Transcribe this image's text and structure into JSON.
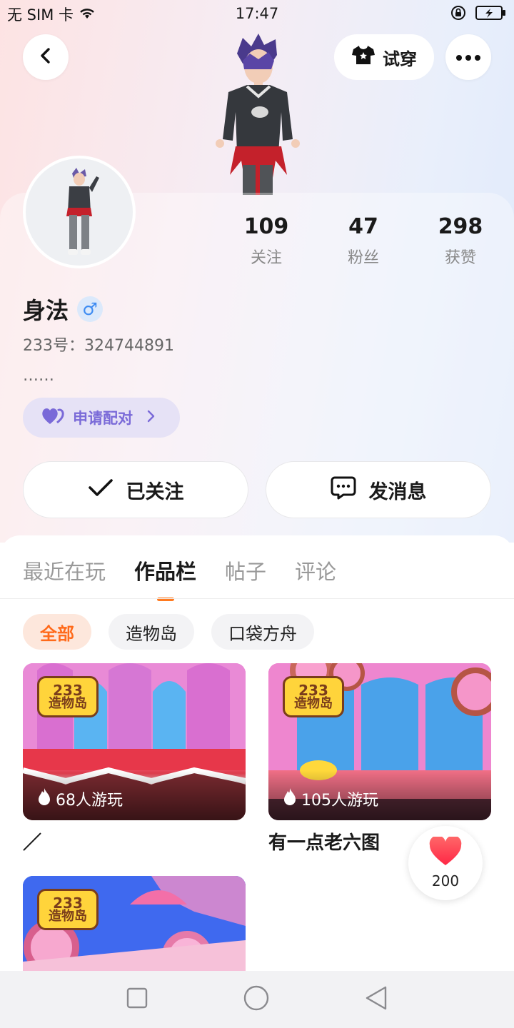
{
  "status_bar": {
    "carrier": "无 SIM 卡",
    "time": "17:47"
  },
  "header": {
    "back_icon": "chevron-left-icon",
    "tryon_label": "试穿",
    "more_icon": "more-horizontal-icon"
  },
  "profile": {
    "stats": [
      {
        "value": "109",
        "label": "关注"
      },
      {
        "value": "47",
        "label": "粉丝"
      },
      {
        "value": "298",
        "label": "获赞"
      }
    ],
    "name": "身法",
    "gender_symbol": "♂",
    "uid": "233号：324744891",
    "bio": "……",
    "pair_label": "申请配对",
    "follow_label": "已关注",
    "message_label": "发消息"
  },
  "tabs": [
    {
      "label": "最近在玩"
    },
    {
      "label": "作品栏"
    },
    {
      "label": "帖子"
    },
    {
      "label": "评论"
    }
  ],
  "filters": [
    {
      "label": "全部"
    },
    {
      "label": "造物岛"
    },
    {
      "label": "口袋方舟"
    }
  ],
  "works": [
    {
      "logo_top": "233",
      "logo_bottom": "造物岛",
      "plays": "68人游玩",
      "title": "／"
    },
    {
      "logo_top": "233",
      "logo_bottom": "造物岛",
      "plays": "105人游玩",
      "title": "有一点老六图"
    },
    {
      "logo_top": "233",
      "logo_bottom": "造物岛"
    }
  ],
  "like_fab": {
    "count": "200"
  },
  "colors": {
    "accent": "#ff7a1f",
    "pair": "#7a6ad8",
    "gender": "#3d8bf2",
    "heart": "#ff3d4f"
  }
}
